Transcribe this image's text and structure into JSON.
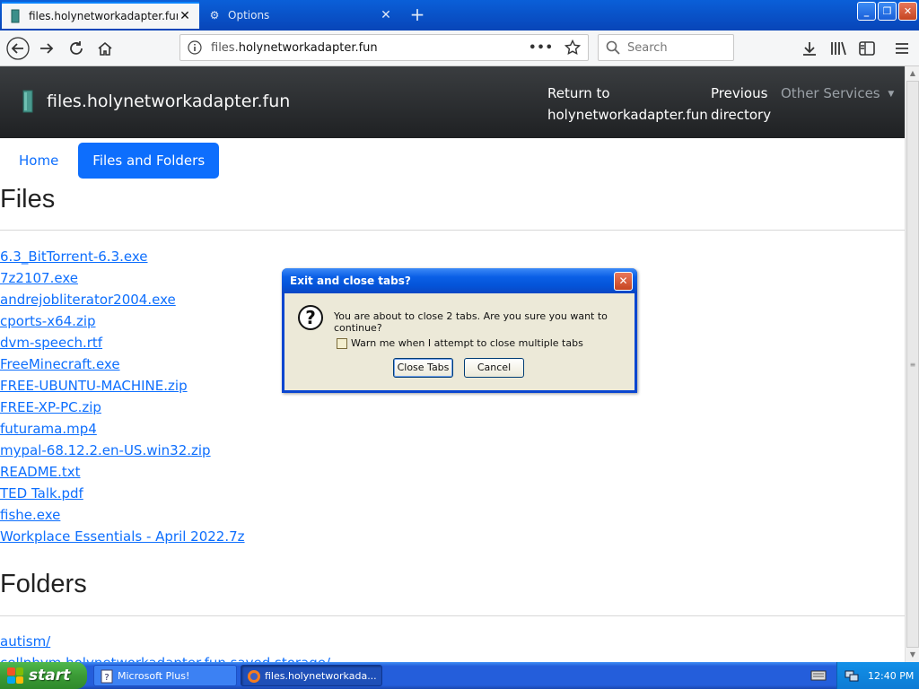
{
  "browser": {
    "tabs": [
      {
        "title": "files.holynetworkadapter.fun",
        "active": true
      },
      {
        "title": "Options",
        "active": false
      }
    ],
    "new_tab_label": "+",
    "url_host": "files.",
    "url_domain": "holynetworkadapter.fun",
    "search_placeholder": "Search",
    "page_actions": "•••"
  },
  "site": {
    "brand": "files.holynetworkadapter.fun",
    "nav": {
      "return_line1": "Return to",
      "return_line2": "holynetworkadapter.fun",
      "previous_line1": "Previous",
      "previous_line2": "directory",
      "other": "Other Services"
    },
    "pills": {
      "home": "Home",
      "files": "Files and Folders"
    }
  },
  "files": {
    "heading": "Files",
    "items": [
      "6.3_BitTorrent-6.3.exe",
      "7z2107.exe",
      "andrejobliterator2004.exe",
      "cports-x64.zip",
      "dvm-speech.rtf",
      "FreeMinecraft.exe",
      "FREE-UBUNTU-MACHINE.zip",
      "FREE-XP-PC.zip",
      "futurama.mp4",
      "mypal-68.12.2.en-US.win32.zip",
      "README.txt",
      "TED Talk.pdf",
      "fishe.exe",
      "Workplace Essentials - April 2022.7z"
    ]
  },
  "folders": {
    "heading": "Folders",
    "items": [
      "autism/",
      "cellphym.holynetworkadapter.fun saved storage/"
    ]
  },
  "dialog": {
    "title": "Exit and close tabs?",
    "message": "You are about to close 2 tabs. Are you sure you want to continue?",
    "checkbox_label": "Warn me when I attempt to close multiple tabs",
    "checkbox_checked": false,
    "confirm": "Close Tabs",
    "cancel": "Cancel"
  },
  "taskbar": {
    "start": "start",
    "buttons": [
      "Microsoft Plus!",
      "files.holynetworkada..."
    ],
    "clock": "12:40 PM"
  }
}
